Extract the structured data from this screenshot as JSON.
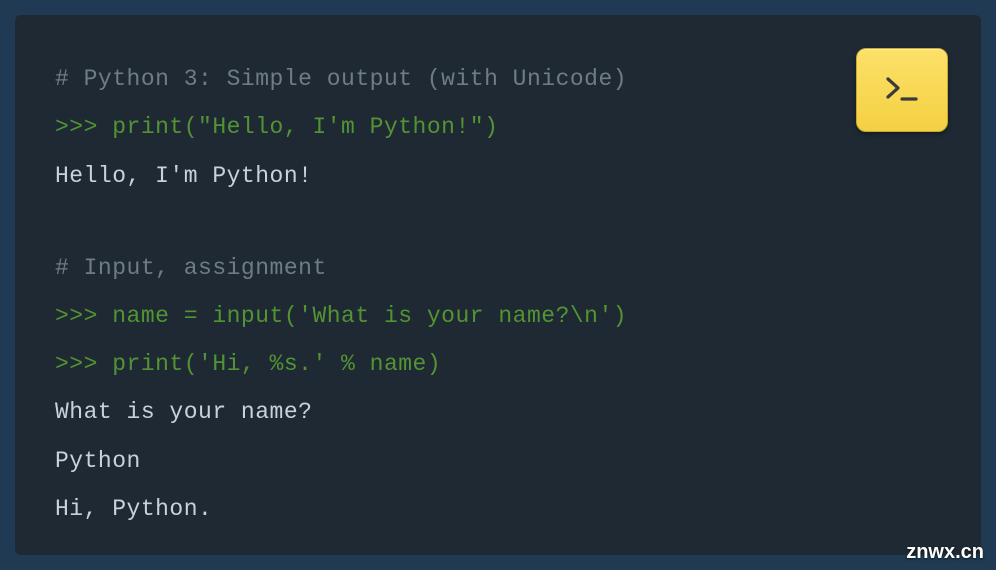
{
  "code": {
    "lines": [
      {
        "type": "comment",
        "text": "# Python 3: Simple output (with Unicode)"
      },
      {
        "type": "input",
        "text": ">>> print(\"Hello, I'm Python!\")"
      },
      {
        "type": "output",
        "text": "Hello, I'm Python!"
      },
      {
        "type": "blank",
        "text": ""
      },
      {
        "type": "comment",
        "text": "# Input, assignment"
      },
      {
        "type": "input",
        "text": ">>> name = input('What is your name?\\n')"
      },
      {
        "type": "input",
        "text": ">>> print('Hi, %s.' % name)"
      },
      {
        "type": "output",
        "text": "What is your name?"
      },
      {
        "type": "output",
        "text": "Python"
      },
      {
        "type": "output",
        "text": "Hi, Python."
      }
    ]
  },
  "button": {
    "icon": "prompt-icon"
  },
  "watermark": "znwx.cn",
  "colors": {
    "frame": "#1f3a52",
    "panel": "#1e2933",
    "comment": "#6f7b85",
    "input": "#529433",
    "output": "#c9d1d9",
    "button_bg_top": "#fce169",
    "button_bg_bottom": "#f4d042"
  }
}
